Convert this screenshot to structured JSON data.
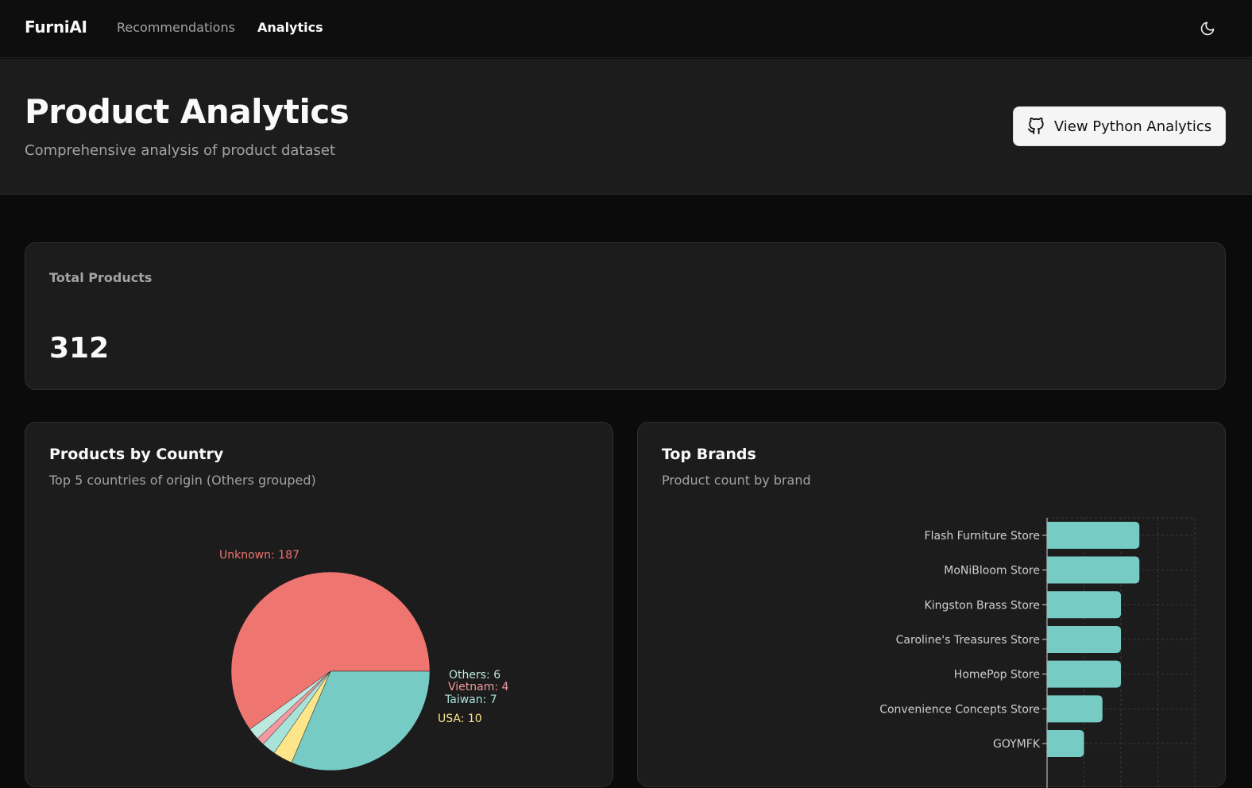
{
  "nav": {
    "brand": "FurniAI",
    "links": [
      {
        "label": "Recommendations",
        "active": false
      },
      {
        "label": "Analytics",
        "active": true
      }
    ],
    "theme_icon": "moon-icon"
  },
  "header": {
    "title": "Product Analytics",
    "subtitle": "Comprehensive analysis of product dataset",
    "button_label": "View Python Analytics",
    "button_icon": "github-icon"
  },
  "stats": {
    "total_label": "Total Products",
    "total_value": "312"
  },
  "country_card": {
    "title": "Products by Country",
    "description": "Top 5 countries of origin (Others grouped)"
  },
  "brands_card": {
    "title": "Top Brands",
    "description": "Product count by brand"
  },
  "colors": {
    "red": "#ef7571",
    "teal": "#76cbc4",
    "yellow": "#fde68a",
    "mint": "#a7e3d8",
    "pink": "#f29a9f"
  },
  "chart_data": [
    {
      "type": "pie",
      "title": "Products by Country",
      "slices": [
        {
          "label": "Unknown",
          "value": 187,
          "display": "Unknown: 187",
          "color": "#ef7571"
        },
        {
          "label": "",
          "value": 98,
          "display": "",
          "color": "#76cbc4"
        },
        {
          "label": "USA",
          "value": 10,
          "display": "USA: 10",
          "color": "#fde68a"
        },
        {
          "label": "Taiwan",
          "value": 7,
          "display": "Taiwan: 7",
          "color": "#a7e3d8"
        },
        {
          "label": "Vietnam",
          "value": 4,
          "display": "Vietnam: 4",
          "color": "#f29a9f"
        },
        {
          "label": "Others",
          "value": 6,
          "display": "Others: 6",
          "color": "#bde8df"
        }
      ]
    },
    {
      "type": "bar",
      "orientation": "horizontal",
      "title": "Top Brands",
      "categories": [
        "Flash Furniture Store",
        "MoNiBloom Store",
        "Kingston Brass Store",
        "Caroline's Treasures Store",
        "HomePop Store",
        "Convenience Concepts Store",
        "GOYMFK"
      ],
      "values": [
        5,
        5,
        4,
        4,
        4,
        3,
        2
      ],
      "xlim": [
        0,
        8
      ],
      "grid": true,
      "color": "#76cbc4"
    }
  ]
}
